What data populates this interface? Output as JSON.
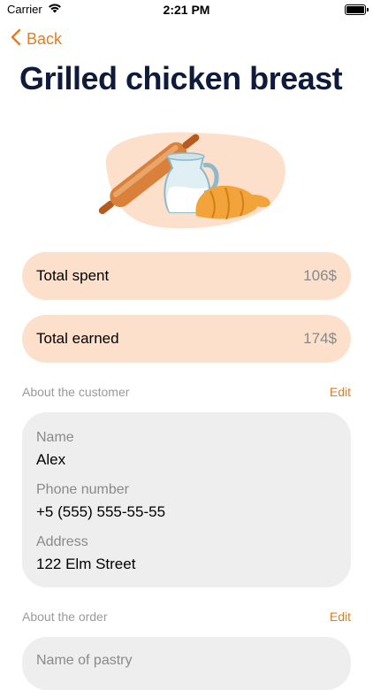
{
  "status": {
    "carrier": "Carrier",
    "time": "2:21 PM"
  },
  "nav": {
    "back_label": "Back"
  },
  "page": {
    "title": "Grilled chicken breast"
  },
  "stats": [
    {
      "label": "Total spent",
      "value": "106$"
    },
    {
      "label": "Total earned",
      "value": "174$"
    }
  ],
  "customer_section": {
    "title": "About the customer",
    "edit_label": "Edit",
    "fields": [
      {
        "label": "Name",
        "value": "Alex"
      },
      {
        "label": "Phone number",
        "value": "+5 (555) 555-55-55"
      },
      {
        "label": "Address",
        "value": "122 Elm Street"
      }
    ]
  },
  "order_section": {
    "title": "About the order",
    "edit_label": "Edit",
    "fields": [
      {
        "label": "Name of pastry"
      }
    ]
  },
  "colors": {
    "accent": "#e87a22",
    "title": "#101a3a",
    "stat_bg": "#fde0cc",
    "card_bg": "#eeeeee"
  },
  "icons": {
    "wifi": "wifi-icon",
    "battery": "battery-icon",
    "back": "chevron-left-icon",
    "illustration": "bakery-illustration"
  }
}
